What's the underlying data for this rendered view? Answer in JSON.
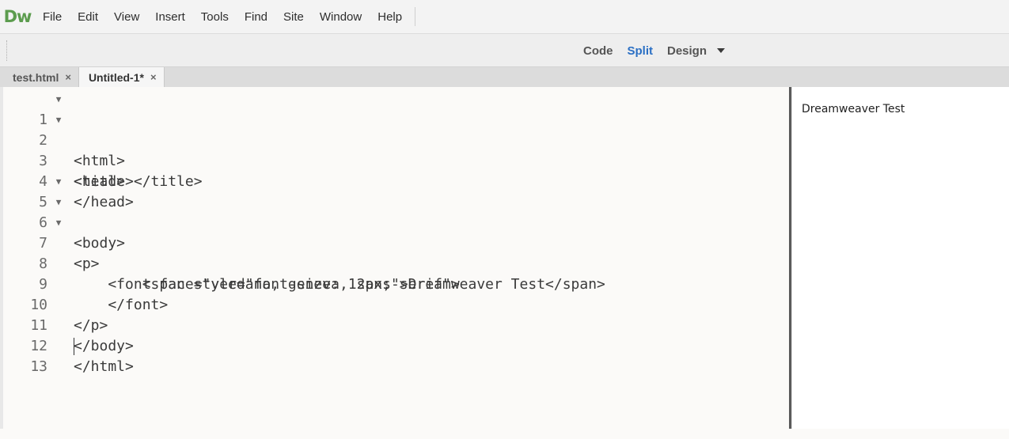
{
  "app": {
    "logo": "Dw"
  },
  "menu": [
    "File",
    "Edit",
    "View",
    "Insert",
    "Tools",
    "Find",
    "Site",
    "Window",
    "Help"
  ],
  "view_switch": {
    "code": "Code",
    "split": "Split",
    "design": "Design",
    "active": "Split"
  },
  "tabs": [
    {
      "label": "test.html",
      "close": "×",
      "active": false
    },
    {
      "label": "Untitled-1*",
      "close": "×",
      "active": true
    }
  ],
  "code_lines": [
    {
      "num": "1",
      "fold": true,
      "text": "<html>"
    },
    {
      "num": "2",
      "fold": true,
      "text": "<head>"
    },
    {
      "num": "3",
      "fold": false,
      "text": "<title></title>"
    },
    {
      "num": "4",
      "fold": false,
      "text": "</head>"
    },
    {
      "num": "5",
      "fold": true,
      "text": "<body>"
    },
    {
      "num": "6",
      "fold": true,
      "text": "<p>"
    },
    {
      "num": "7",
      "fold": true,
      "text": "    <font face=\"verdana, geneva, sans-serif\">"
    },
    {
      "num": "8",
      "fold": false,
      "text": "        <span style=\"font-size: 12px;\">Dreamweaver Test</span>"
    },
    {
      "num": "9",
      "fold": false,
      "text": "    </font>"
    },
    {
      "num": "10",
      "fold": false,
      "text": "</p>"
    },
    {
      "num": "11",
      "fold": false,
      "text": "</body>"
    },
    {
      "num": "12",
      "fold": false,
      "text": "</html>"
    },
    {
      "num": "13",
      "fold": false,
      "text": ""
    }
  ],
  "fold_glyph": "▼",
  "preview": {
    "text": "Dreamweaver Test"
  },
  "colors": {
    "accent": "#2a6fc4",
    "logo": "#5c9c4e"
  }
}
